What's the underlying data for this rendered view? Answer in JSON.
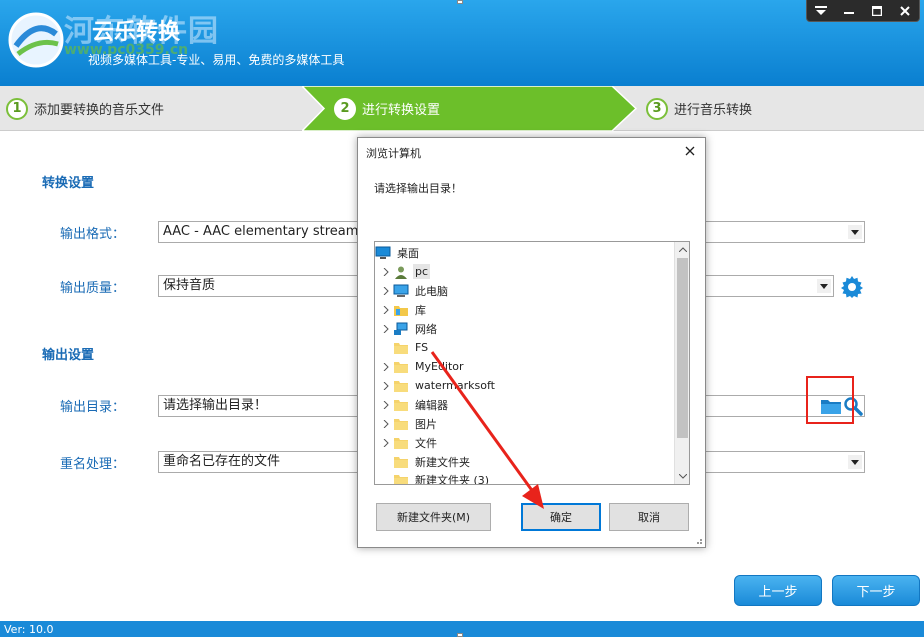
{
  "header": {
    "watermark": "河东软件园",
    "watermark_url": "www.pc0359.cn",
    "app_title": "云乐转换",
    "subtitle": "视频多媒体工具-专业、易用、免费的多媒体工具"
  },
  "steps": [
    {
      "num": "1",
      "label": "添加要转换的音乐文件"
    },
    {
      "num": "2",
      "label": "进行转换设置"
    },
    {
      "num": "3",
      "label": "进行音乐转换"
    }
  ],
  "convert_settings": {
    "title": "转换设置",
    "format_label": "输出格式：",
    "format_value": "AAC - AAC elementary stream (",
    "quality_label": "输出质量：",
    "quality_value": "保持音质"
  },
  "output_settings": {
    "title": "输出设置",
    "dir_label": "输出目录：",
    "dir_value": "请选择输出目录！",
    "rename_label": "重名处理：",
    "rename_value": "重命名已存在的文件"
  },
  "nav": {
    "prev": "上一步",
    "next": "下一步"
  },
  "version": "Ver: 10.0",
  "dialog": {
    "title": "浏览计算机",
    "prompt": "请选择输出目录！",
    "tree": [
      {
        "label": "桌面",
        "icon": "desktop-icon"
      },
      {
        "label": "pc",
        "icon": "user-icon"
      },
      {
        "label": "此电脑",
        "icon": "computer-icon"
      },
      {
        "label": "库",
        "icon": "library-icon"
      },
      {
        "label": "网络",
        "icon": "network-icon"
      },
      {
        "label": "FS",
        "icon": "folder-icon"
      },
      {
        "label": "MyEditor",
        "icon": "folder-icon"
      },
      {
        "label": "watermarksoft",
        "icon": "folder-icon"
      },
      {
        "label": "编辑器",
        "icon": "folder-icon"
      },
      {
        "label": "图片",
        "icon": "folder-icon"
      },
      {
        "label": "文件",
        "icon": "folder-icon"
      },
      {
        "label": "新建文件夹",
        "icon": "folder-icon"
      },
      {
        "label": "新建文件夹 (3)",
        "icon": "folder-icon"
      }
    ],
    "new_folder_btn": "新建文件夹(M)",
    "ok_btn": "确定",
    "cancel_btn": "取消"
  },
  "colors": {
    "header_blue": "#0a7fd0",
    "step_green": "#7bbf3a",
    "label_blue": "#1a6bb5",
    "highlight_red": "#e8231b"
  }
}
